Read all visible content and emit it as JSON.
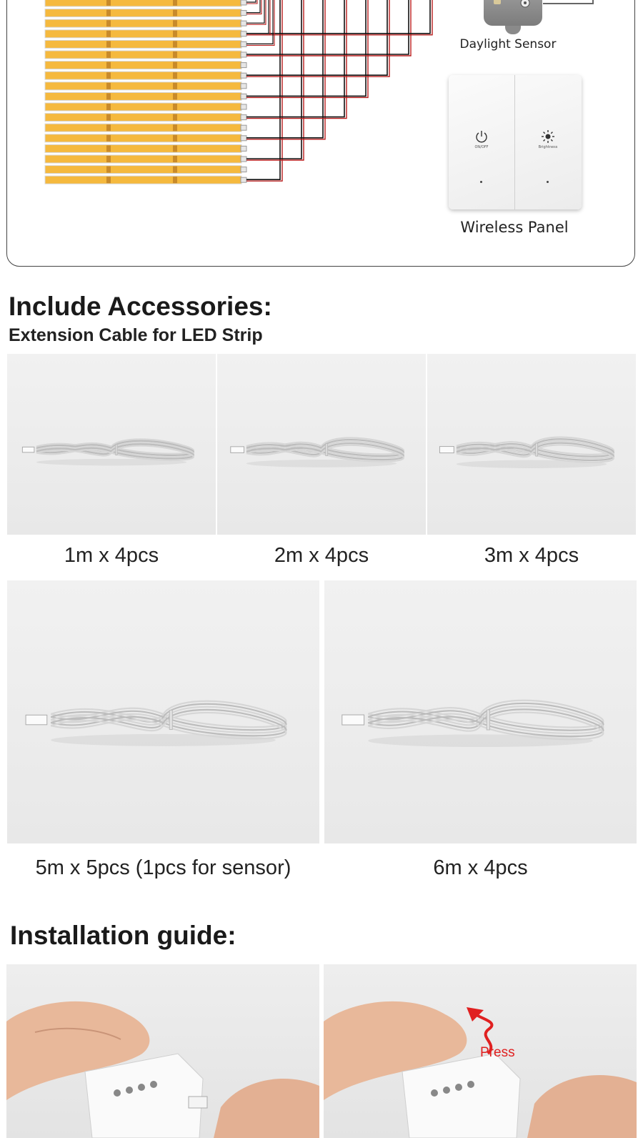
{
  "diagram": {
    "sensor_label": "Daylight Sensor",
    "panel_label": "Wireless Panel",
    "panel_buttons": [
      {
        "icon": "power-icon",
        "caption": "ON/OFF"
      },
      {
        "icon": "brightness-icon",
        "caption": "Brightness"
      }
    ],
    "colors": {
      "strip": "#f5b93e",
      "wire_red": "#b81c1c",
      "wire_black": "#111111"
    }
  },
  "accessories": {
    "title": "Include Accessories:",
    "subtitle": "Extension Cable for LED Strip",
    "cables": [
      {
        "caption": "1m x 4pcs"
      },
      {
        "caption": "2m x 4pcs"
      },
      {
        "caption": "3m x 4pcs"
      },
      {
        "caption": "5m x 5pcs (1pcs for sensor)"
      },
      {
        "caption": "6m x 4pcs"
      }
    ]
  },
  "installation": {
    "title": "Installation guide:",
    "press_label": "Press"
  }
}
